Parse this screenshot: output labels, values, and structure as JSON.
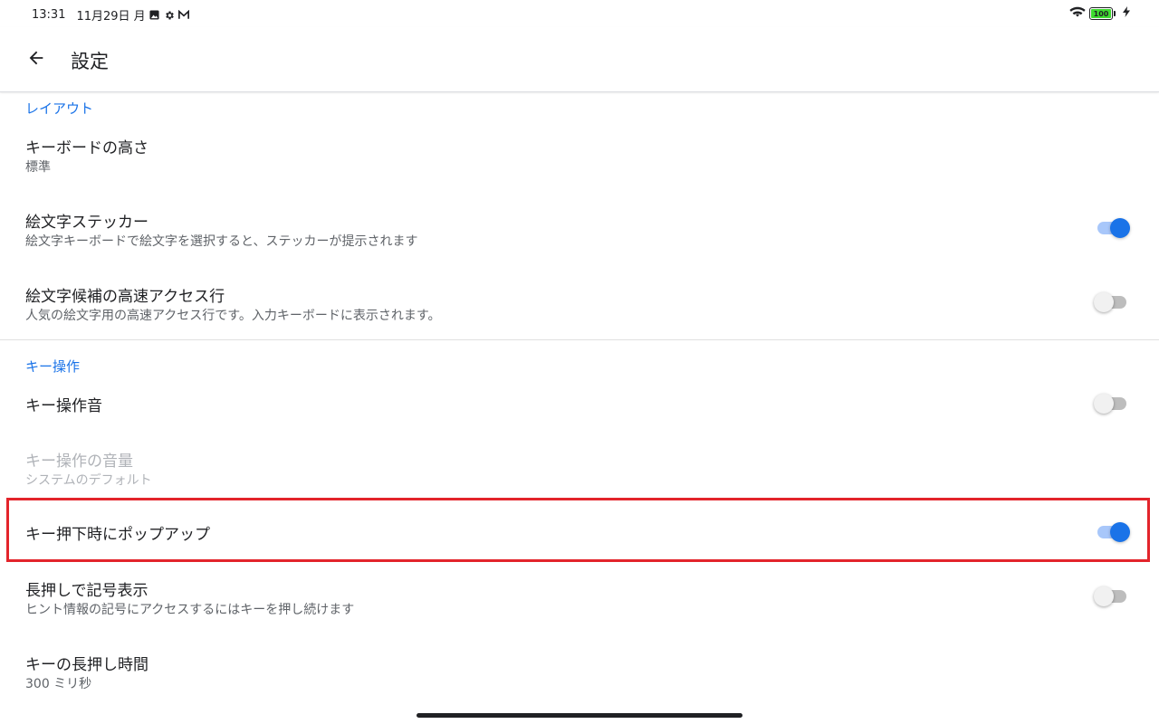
{
  "status_bar": {
    "time": "13:31",
    "date": "11月29日 月",
    "icons_left": [
      "photo-icon",
      "gear-icon",
      "mail-icon"
    ],
    "icons_right": [
      "wifi-icon",
      "battery-icon",
      "charging-icon"
    ],
    "battery_level": "100"
  },
  "app_bar": {
    "back_icon": "arrow-back-icon",
    "title": "設定"
  },
  "sections": {
    "layout": {
      "header": "レイアウト",
      "keyboard_height": {
        "title": "キーボードの高さ",
        "summary": "標準"
      },
      "emoji_sticker": {
        "title": "絵文字ステッカー",
        "summary": "絵文字キーボードで絵文字を選択すると、ステッカーが提示されます",
        "enabled": true
      },
      "emoji_quick_access": {
        "title": "絵文字候補の高速アクセス行",
        "summary": "人気の絵文字用の高速アクセス行です。入力キーボードに表示されます。",
        "enabled": false
      }
    },
    "key_operation": {
      "header": "キー操作",
      "key_sound": {
        "title": "キー操作音",
        "enabled": false
      },
      "key_volume": {
        "title": "キー操作の音量",
        "summary": "システムのデフォルト",
        "disabled": true
      },
      "key_popup": {
        "title": "キー押下時にポップアップ",
        "enabled": true
      },
      "long_press_symbols": {
        "title": "長押しで記号表示",
        "summary": "ヒント情報の記号にアクセスするにはキーを押し続けます",
        "enabled": false
      },
      "long_press_delay": {
        "title": "キーの長押し時間",
        "summary": "300 ミリ秒"
      }
    }
  },
  "colors": {
    "accent": "#1a73e8",
    "highlight_box": "#e3242b"
  }
}
